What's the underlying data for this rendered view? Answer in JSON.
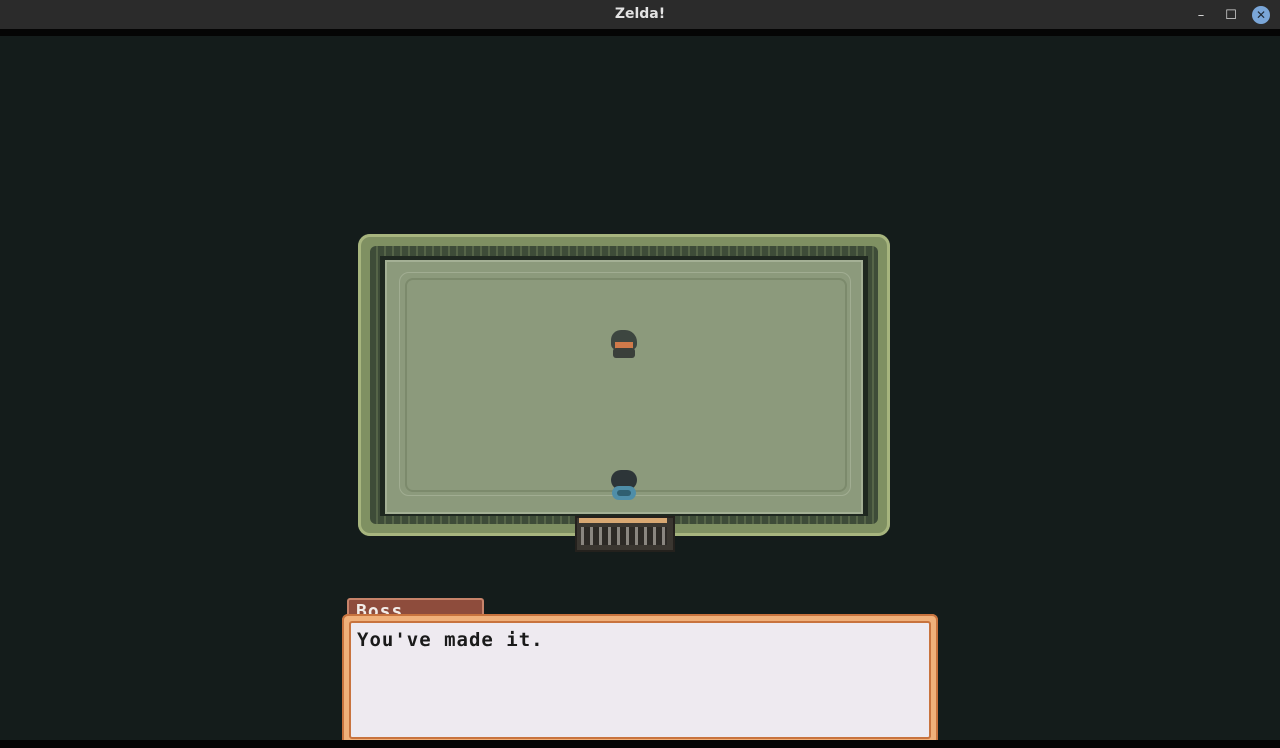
{
  "window": {
    "title": "Zelda!",
    "controls": {
      "minimize": "–",
      "maximize": "☐",
      "close": "✕"
    }
  },
  "dialog": {
    "speaker": "Boss",
    "text": "You've made it."
  },
  "colors": {
    "background": "#141c1b",
    "floor": "#8c9a7c",
    "wall": "#7f9062",
    "name_tab": "#8e4c3c",
    "dialog_border": "#f0b07a",
    "dialog_bg": "#eeeaf0"
  }
}
